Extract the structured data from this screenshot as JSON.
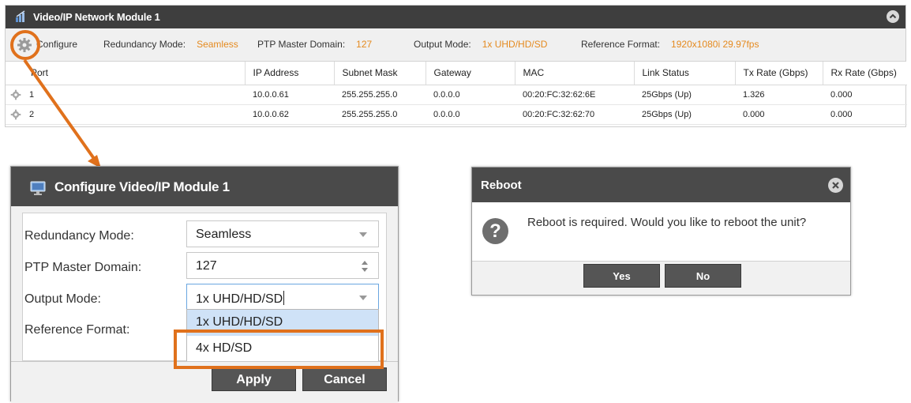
{
  "module": {
    "title": "Video/IP Network Module 1",
    "configure_label": "Configure",
    "settings": [
      {
        "key": "Redundancy Mode:",
        "value": "Seamless"
      },
      {
        "key": "PTP Master Domain:",
        "value": "127"
      },
      {
        "key": "Output Mode:",
        "value": "1x UHD/HD/SD"
      },
      {
        "key": "Reference Format:",
        "value": "1920x1080i 29.97fps"
      }
    ],
    "table": {
      "headers": [
        "Port",
        "IP Address",
        "Subnet Mask",
        "Gateway",
        "MAC",
        "Link Status",
        "Tx Rate (Gbps)",
        "Rx Rate (Gbps)"
      ],
      "rows": [
        [
          "1",
          "10.0.0.61",
          "255.255.255.0",
          "0.0.0.0",
          "00:20:FC:32:62:6E",
          "25Gbps (Up)",
          "1.326",
          "0.000"
        ],
        [
          "2",
          "10.0.0.62",
          "255.255.255.0",
          "0.0.0.0",
          "00:20:FC:32:62:70",
          "25Gbps (Up)",
          "0.000",
          "0.000"
        ]
      ]
    }
  },
  "configure_dialog": {
    "title": "Configure Video/IP Module 1",
    "fields": {
      "redundancy_label": "Redundancy Mode:",
      "redundancy_value": "Seamless",
      "ptp_label": "PTP Master Domain:",
      "ptp_value": "127",
      "output_label": "Output Mode:",
      "output_value": "1x UHD/HD/SD",
      "reference_label": "Reference Format:"
    },
    "dropdown_options": [
      "1x UHD/HD/SD",
      "4x HD/SD"
    ],
    "apply_label": "Apply",
    "cancel_label": "Cancel"
  },
  "reboot_dialog": {
    "title": "Reboot",
    "message": "Reboot is required. Would you like to reboot the unit?",
    "icon_text": "?",
    "yes_label": "Yes",
    "no_label": "No"
  },
  "colors": {
    "accent": "#e0711c",
    "value_text": "#e58a1f",
    "title_bar": "#3e3e3e",
    "dialog_title": "#4a4a4a",
    "button": "#555555",
    "dropdown_selected": "#cfe2f7"
  },
  "icons": [
    "network-icon",
    "collapse-icon",
    "gear-icon",
    "monitor-icon",
    "close-icon",
    "question-icon"
  ]
}
